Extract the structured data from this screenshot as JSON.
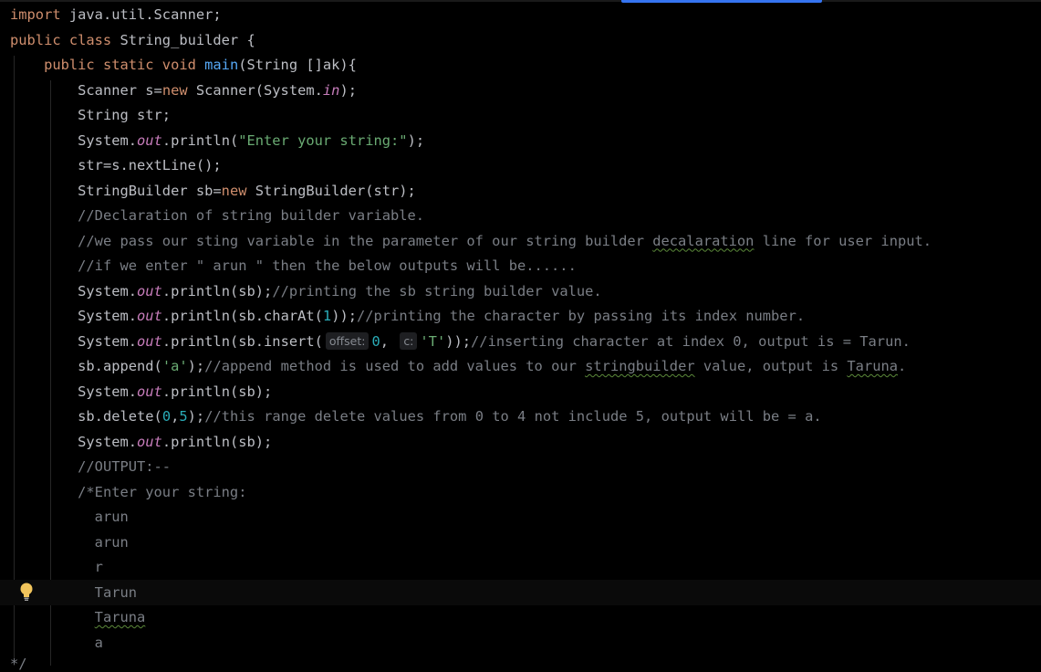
{
  "editor": {
    "line_import": "import java.util.Scanner;",
    "line_class_kw": "public class ",
    "line_class_name": "String_builder {",
    "main_kw": "public static void ",
    "main_name": "main",
    "main_params": "(String []ak){",
    "scanner_a": "Scanner s=",
    "kw_new": "new",
    "scanner_b": " Scanner(System.",
    "field_in": "in",
    "close_paren_semi": ");",
    "string_decl": "String str;",
    "sys": "System.",
    "field_out": "out",
    "println_open": ".println(",
    "prompt_literal": "\"Enter your string:\"",
    "nextline": "str=s.nextLine();",
    "sb_a": "StringBuilder sb=",
    "sb_b": " StringBuilder(str);",
    "comment_1": "//Declaration of string builder variable.",
    "comment_2a": "//we pass our sting variable in the parameter of our string builder ",
    "comment_2_typo": "decalaration",
    "comment_2b": " line for user input.",
    "comment_3": "//if we enter \" arun \" then the below outputs will be......",
    "print_sb": "sb);",
    "comment_4": "//printing the sb string builder value.",
    "charat_a": "sb.charAt(",
    "charat_num": "1",
    "charat_b": "));",
    "comment_5": "//printing the character by passing its index number.",
    "insert_a": "sb.insert(",
    "hint_offset": "offset:",
    "insert_zero": "0",
    "comma": ", ",
    "hint_c": "c:",
    "insert_char": "'T'",
    "insert_b": "));",
    "comment_6": "//inserting character at index 0, output is = Tarun.",
    "append_a": "sb.append(",
    "append_char": "'a'",
    "append_b": ");",
    "comment_7a": "//append method is used to add values to our ",
    "comment_7_typo": "stringbuilder",
    "comment_7b": " value, output is ",
    "comment_7_typo2": "Taruna",
    "comment_7c": ".",
    "delete_a": "sb.delete(",
    "delete_0": "0",
    "delete_comma": ",",
    "delete_5": "5",
    "delete_b": ");",
    "comment_8": "//this range delete values from 0 to 4 not include 5, output will be = a.",
    "comment_output": "//OUTPUT:--",
    "comment_block_start": "/*Enter your string:",
    "out_1": "arun",
    "out_2": "arun",
    "out_3": "r",
    "out_4": "Tarun",
    "out_5": "Taruna",
    "out_6": "a",
    "fragment": "*/"
  },
  "colors": {
    "background": "#000000",
    "keyword": "#cf8e6d",
    "function": "#56a8f5",
    "string": "#6aab73",
    "number": "#2aacb8",
    "static_field": "#c77dbb",
    "comment": "#7a7e85",
    "text": "#bcbec4",
    "active_tab": "#3574f0"
  },
  "icons": {
    "intention": "lightbulb-icon"
  }
}
